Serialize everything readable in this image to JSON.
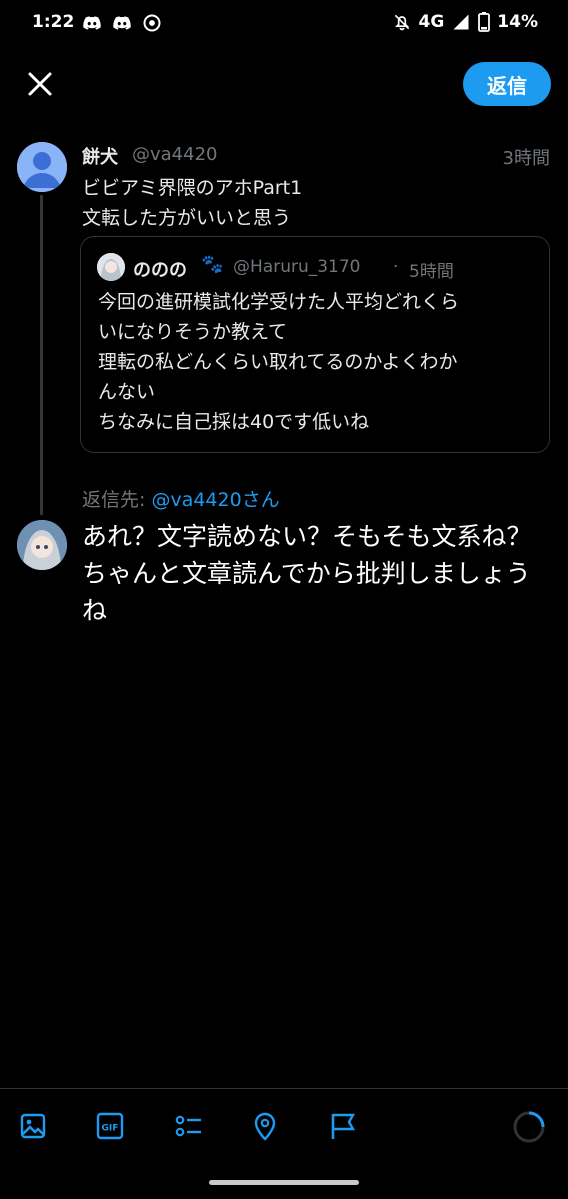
{
  "status_bar": {
    "time": "1:22",
    "network": "4G",
    "battery": "14%"
  },
  "header": {
    "reply_button": "返信"
  },
  "original_tweet": {
    "name": "餅犬",
    "handle": "@va4420",
    "time": "3時間",
    "lines": [
      "ビビアミ界隈のアホPart1",
      "文転した方がいいと思う"
    ]
  },
  "quoted_tweet": {
    "name": "ののの",
    "emoji": "🐾",
    "handle": "@Haruru_3170",
    "separator": "·",
    "time": "5時間",
    "lines": [
      "今回の進研模試化学受けた人平均どれくら",
      "いになりそうか教えて",
      "理転の私どんくらい取れてるのかよくわか",
      "んない",
      "ちなみに自己採は40です低いね"
    ]
  },
  "reply": {
    "label": "返信先:",
    "target": "@va4420さん",
    "lines": [
      "あれ？文字読めない？そもそも文系ね？",
      "ちゃんと文章読んでから批判しましょう",
      "ね"
    ]
  },
  "toolbar": {
    "gif_label": "GIF"
  },
  "colors": {
    "accent": "#1d9bf0",
    "background": "#000000",
    "secondary_text": "#71767b"
  }
}
